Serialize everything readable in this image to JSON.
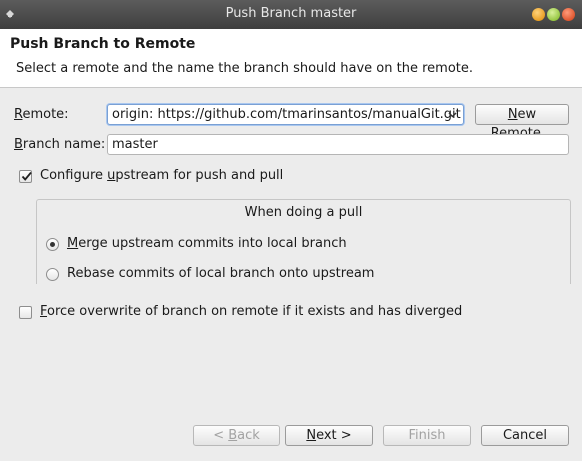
{
  "window": {
    "title": "Push Branch master"
  },
  "header": {
    "title": "Push Branch to Remote",
    "description": "Select a remote and the name the branch should have on the remote."
  },
  "form": {
    "remote_label_mnemonic": "R",
    "remote_label_rest": "emote:",
    "remote_value": "origin: https://github.com/tmarinsantos/manualGit.git",
    "new_remote_mnemonic": "N",
    "new_remote_rest": "ew Remote...",
    "branch_label_mnemonic": "B",
    "branch_label_rest": "ranch name:",
    "branch_value": "master",
    "configure_upstream_pre": "Configure ",
    "configure_upstream_mnemonic": "u",
    "configure_upstream_post": "pstream for push and pull",
    "configure_upstream_checked": true,
    "pull_group_title": "When doing a pull",
    "merge_mnemonic": "M",
    "merge_rest": "erge upstream commits into local branch",
    "merge_selected": true,
    "rebase_label": "Rebase commits of local branch onto upstream",
    "force_mnemonic": "F",
    "force_rest": "orce overwrite of branch on remote if it exists and has diverged",
    "force_checked": false
  },
  "footer": {
    "back_pre": "< ",
    "back_mnemonic": "B",
    "back_rest": "ack",
    "next_mnemonic": "N",
    "next_rest": "ext >",
    "finish_label": "Finish",
    "cancel_label": "Cancel"
  }
}
